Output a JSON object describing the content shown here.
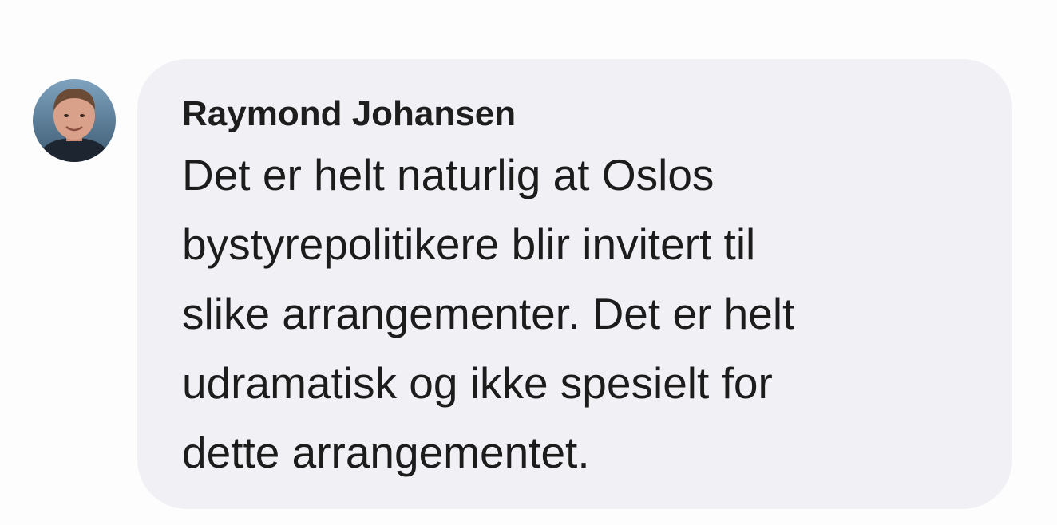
{
  "comment": {
    "author": "Raymond Johansen",
    "text_lines": [
      "Det er helt naturlig at Oslos",
      "bystyrepolitikere blir invitert til",
      "slike arrangementer. Det er helt",
      "udramatisk og ikke spesielt for",
      "dette arrangementet."
    ],
    "avatar_icon": "profile-photo"
  },
  "colors": {
    "bubble_background": "#f0f0f5",
    "page_background": "#fdfdfe",
    "text": "#1c1c1c"
  }
}
